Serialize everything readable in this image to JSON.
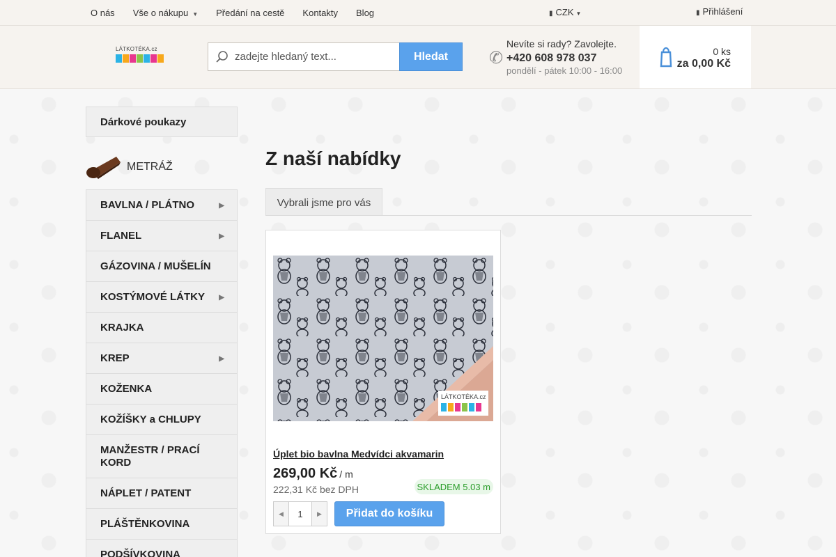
{
  "topbar": {
    "nav": [
      {
        "label": "O nás",
        "dropdown": false
      },
      {
        "label": "Vše o nákupu",
        "dropdown": true
      },
      {
        "label": "Předání na cestě",
        "dropdown": false
      },
      {
        "label": "Kontakty",
        "dropdown": false
      },
      {
        "label": "Blog",
        "dropdown": false
      }
    ],
    "currency": "CZK",
    "login": "Přihlášení"
  },
  "header": {
    "logo_text": "LÁTKOTÉKA.cz",
    "search": {
      "placeholder": "zadejte hledaný text...",
      "button": "Hledat"
    },
    "help": {
      "title": "Nevíte si rady? Zavolejte.",
      "phone": "+420 608 978 037",
      "hours": "pondělí - pátek 10:00 - 16:00"
    },
    "cart": {
      "count": "0 ks",
      "total": "za 0,00 Kč"
    }
  },
  "sidebar": {
    "gift": "Dárkové poukazy",
    "section": "METRÁŽ",
    "categories": [
      {
        "label": "BAVLNA / PLÁTNO",
        "has_sub": true
      },
      {
        "label": "FLANEL",
        "has_sub": true
      },
      {
        "label": "GÁZOVINA / MUŠELÍN",
        "has_sub": false
      },
      {
        "label": "KOSTÝMOVÉ LÁTKY",
        "has_sub": true
      },
      {
        "label": "KRAJKA",
        "has_sub": false
      },
      {
        "label": "KREP",
        "has_sub": true
      },
      {
        "label": "KOŽENKA",
        "has_sub": false
      },
      {
        "label": "KOŽÍŠKY a CHLUPY",
        "has_sub": false
      },
      {
        "label": "MANŽESTR / PRACÍ KORD",
        "has_sub": false
      },
      {
        "label": "NÁPLET / PATENT",
        "has_sub": false
      },
      {
        "label": "PLÁŠTĚNKOVINA",
        "has_sub": false
      },
      {
        "label": "PODŠÍVKOVINA",
        "has_sub": false
      }
    ]
  },
  "main": {
    "title": "Z naší nabídky",
    "tab": "Vybrali jsme pro vás",
    "product": {
      "name": "Úplet bio bavlna Medvídci akvamarin",
      "price": "269,00 Kč",
      "unit": "/ m",
      "price_novat": "222,31 Kč bez DPH",
      "stock": "SKLADEM 5.03 m",
      "qty": "1",
      "add_label": "Přidat do košíku",
      "image_logo": "LÁTKOTÉKA.cz"
    }
  },
  "colors": {
    "accent": "#5aa2ec",
    "stock_green": "#2a9d2a",
    "bg": "#f7f7f7"
  },
  "icons": {
    "phone": "phone-icon",
    "cart": "cart-icon",
    "search": "search-icon",
    "user": "user-icon",
    "money": "money-icon"
  }
}
